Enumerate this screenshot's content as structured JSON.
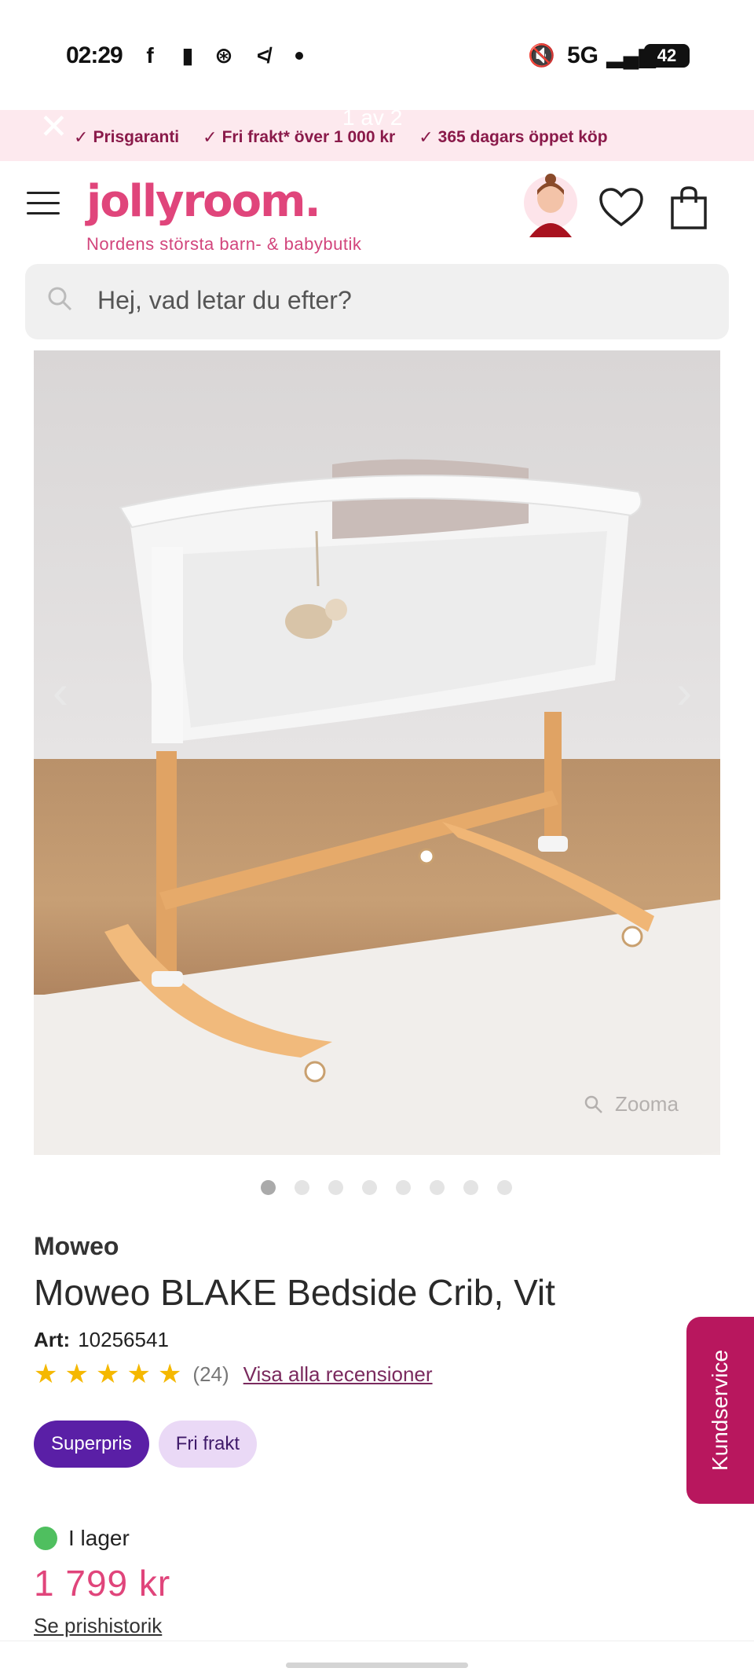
{
  "status_bar": {
    "time": "02:29",
    "network": "5G",
    "battery": "42"
  },
  "promo": {
    "pager": "1 av 2",
    "items": [
      "Prisgaranti",
      "Fri frakt* över 1 000 kr",
      "365 dagars öppet köp"
    ]
  },
  "header": {
    "logo": "jollyroom.",
    "tagline": "Nordens största barn- & babybutik"
  },
  "search": {
    "placeholder": "Hej, vad letar du efter?"
  },
  "gallery": {
    "zoom_label": "Zooma",
    "dots_total": 8,
    "active_dot": 1
  },
  "product": {
    "brand": "Moweo",
    "title": "Moweo BLAKE Bedside Crib, Vit",
    "art_label": "Art:",
    "art_number": "10256541",
    "rating": 5,
    "review_count": "(24)",
    "reviews_link": "Visa alla recensioner",
    "badges": [
      "Superpris",
      "Fri frakt"
    ],
    "stock": "I lager",
    "price": "1 799 kr",
    "price_history": "Se prishistorik"
  },
  "kundservice": "Kundservice",
  "colors": {
    "brand_pink": "#e0457b",
    "superpris": "#5a1fa6",
    "fri_frakt": "#ead9f6",
    "kundservice": "#b8175e",
    "in_stock": "#4fbf5f",
    "stars": "#f5b800"
  }
}
